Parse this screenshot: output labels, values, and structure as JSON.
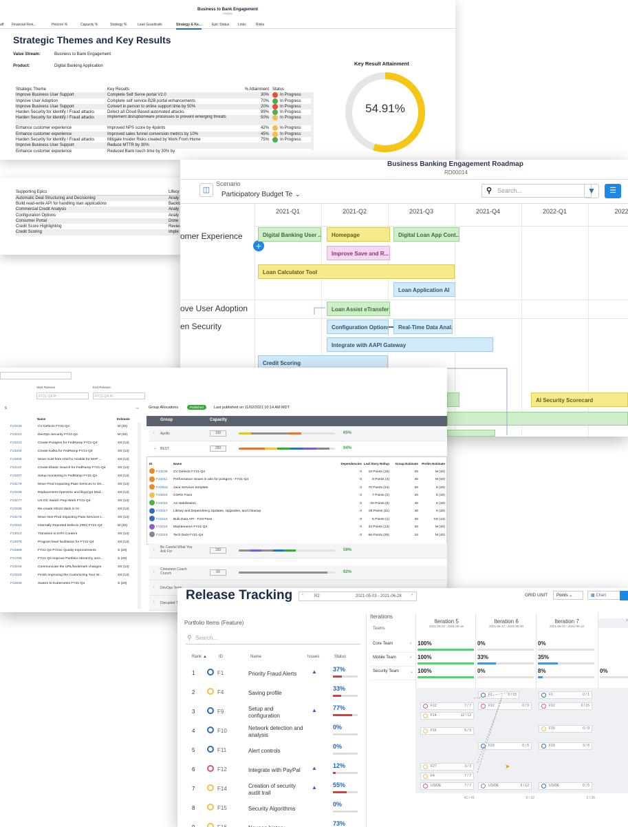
{
  "panel1": {
    "app_title": "Business to Bank Engagement",
    "app_code": "VS0002",
    "tabs": [
      "aff",
      "Financial Revi...",
      "Horizon %",
      "Capacity %",
      "Strategy %",
      "Lean Guardrails",
      "Strategy & Ke...",
      "Epic Status",
      "Links",
      "Risks"
    ],
    "heading": "Strategic Themes and Key Results",
    "value_stream_label": "Value Stream:",
    "value_stream": "Business to Bank Engagement",
    "product_label": "Product:",
    "product": "Digital Banking Application",
    "cols": [
      "Strategic Theme",
      "Key Results",
      "% Attainment",
      "Status"
    ],
    "rows": [
      {
        "theme": "Improve Business User Support",
        "kr": "Complete Self Serve portal V2.0",
        "pct": "30%",
        "status": "In Progress",
        "color": "#e8503a"
      },
      {
        "theme": "Improve User Adoption",
        "kr": "Complete self service B2B portal enhancements",
        "pct": "70%",
        "status": "In Progress",
        "color": "#4caf50"
      },
      {
        "theme": "Improve Business User Support",
        "kr": "Convert in person to online support time by 50%",
        "pct": "20%",
        "status": "In Progress",
        "color": "#e8503a"
      },
      {
        "theme": "Harden Security for Identify / Fraud attacks",
        "kr": "Detect all Cloud Based automated attacks",
        "pct": "99%",
        "status": "In Progress",
        "color": "#4caf50"
      },
      {
        "theme": "Harden Security for Identify / Fraud attacks",
        "kr": "Implement disruptionware processes to prevent emerging threats",
        "pct": "50%",
        "status": "In Progress",
        "color": "#f5c04a"
      },
      {
        "theme": "Enhance customer experience",
        "kr": "Improved NPS score by 4points",
        "pct": "42%",
        "status": "In Progress",
        "color": "#f5c04a"
      },
      {
        "theme": "Enhance customer experience",
        "kr": "Improved sales funnel conversion metrics by 10%",
        "pct": "45%",
        "status": "In Progress",
        "color": "#f5c04a"
      },
      {
        "theme": "Harden Security for Identify / Fraud attacks",
        "kr": "Mitigate Insider Risks created by Work From Home",
        "pct": "75%",
        "status": "In Progress",
        "color": "#4caf50"
      },
      {
        "theme": "Improve Business User Support",
        "kr": "Reduce MTTR by 30%",
        "pct": "",
        "status": "",
        "color": ""
      },
      {
        "theme": "Enhance customer experience",
        "kr": "Reduced Bank touch time by 30% by",
        "pct": "",
        "status": "",
        "color": ""
      }
    ],
    "gauge_title": "Key Result Attainment",
    "gauge_value": "54.91%",
    "gauge_fraction": 0.5491,
    "epics_col": "Supporting Epics",
    "lifecycle_col": "Lifecy",
    "epics": [
      {
        "name": "Automatic Deal Structuring and Decisioning",
        "lc": "Analy"
      },
      {
        "name": "Build read-write API for handling loan applications",
        "lc": "Backlo"
      },
      {
        "name": "Commercial Credit Analysis",
        "lc": "Analy"
      },
      {
        "name": "Configuration Options",
        "lc": "Analy"
      },
      {
        "name": "Consumer Portal",
        "lc": "Done"
      },
      {
        "name": "Credit Score Highlighting",
        "lc": "Reviev"
      },
      {
        "name": "Credit Scoring",
        "lc": "Imple"
      }
    ]
  },
  "panel2": {
    "title": "Business Banking Engagement Roadmap",
    "code": "RD00014",
    "scenario_label": "Scenario",
    "scenario_value": "Participatory Budget Te",
    "search_placeholder": "Search...",
    "quarters": [
      "2021-Q1",
      "2021-Q2",
      "2021-Q3",
      "2021-Q4",
      "2022-Q1",
      "2022"
    ],
    "themes": [
      "omer Experience",
      "ove User Adoption",
      "en Security"
    ],
    "items": [
      "Digital Banking User ...",
      "Homepage",
      "Digital Loan App Cont...",
      "Improve Save and R...",
      "Loan Calculator Tool",
      "Loan Application AI",
      "Loan Assist eTransfer",
      "Configuration Options",
      "Real-Time Data Anal...",
      "Integrate with AAPI Gateway",
      "Credit Scoring",
      "AI Security Scorecard"
    ]
  },
  "panel3": {
    "start_release_label": "Start Release",
    "start_release": "FY21-Q4 PI",
    "end_release_label": "End Release",
    "end_release": "FY21-Q4 PI",
    "list_title": "s",
    "list_cols": [
      "Name",
      "Estimate"
    ],
    "list": [
      [
        "F23108",
        "CV Defects FY21-Q4",
        "M (40)"
      ],
      [
        "F23161",
        "DevOps Security FY21-Q4",
        "M (40)"
      ],
      [
        "F23231",
        "Create Postgres for FedRamp FY21-Q4",
        "XS (13)"
      ],
      [
        "F23204",
        "Create Kafka for FedRamp FY21-Q4",
        "XS (13)"
      ],
      [
        "F23205",
        "Move ALM from Chef to Ansible for MVP ...",
        "XS (13)"
      ],
      [
        "F22110",
        "Create Elastic Search for FedRamp FY21-Q4",
        "XS (13)"
      ],
      [
        "F23207",
        "Setup monitoring in FedRamp FY21-Q4",
        "XS (13)"
      ],
      [
        "F23179",
        "Move Prod Impacting Paas Services to GK...",
        "XS (13)"
      ],
      [
        "F23198",
        "Replacement OpenSSL and libgcrypt Mod...",
        "XS (13)"
      ],
      [
        "F23177",
        "US DC Switch Prep Work FY21-Q4",
        "XS (13)"
      ],
      [
        "F23195",
        "Re-create Ghost slack in GI",
        "XS (13)"
      ],
      [
        "F23178",
        "Move Non-Prod Impacting Paas Services t...",
        "XS (13)"
      ],
      [
        "F23181",
        "Internally Reported Defects (IRD) FY21-Q4",
        "M (40)"
      ],
      [
        "F23014",
        "Transition to DITA Content",
        "XS (13)"
      ],
      [
        "F23078",
        "Program level facilitation for FY21-Q4",
        "XS (13)"
      ],
      [
        "F22869",
        "FY21-Q4 PI Doc Quality Improvements",
        "S (20)"
      ],
      [
        "F21765",
        "FY21-Q4 Improve Portfolio Hierarchy sect...",
        "S (20)"
      ],
      [
        "F23194",
        "Communicate the URL/bookmark changes",
        "XS (13)"
      ],
      [
        "F23160",
        "Finish Improving the Customizing Your W...",
        "XS (13)"
      ],
      [
        "F22636",
        "Swarm to Kubernetes FY21-Q4",
        "S (20)"
      ]
    ],
    "alloc_title": "Group Allocations",
    "published_badge": "Published",
    "published_text": "Last published on 11/02/2021 10:14 AM MDT",
    "group_col": "Group",
    "capacity_col": "Capacity",
    "groups": [
      {
        "name": "Apollo",
        "cap": "100",
        "pct": "65%"
      },
      {
        "name": "BEST",
        "cap": "250",
        "pct": "94%"
      }
    ],
    "sub_cols": [
      "ID",
      "Name",
      "Dependencies",
      "Leaf Story Rollup",
      "Group Estimate",
      "Prelim Estimate"
    ],
    "sub_rows": [
      [
        "F23108",
        "CV Defects FY21-Q4",
        "0",
        "19 Points (16)",
        "25",
        "M (40)",
        "#f08a24"
      ],
      [
        "F23211",
        "Performance Issues in alm for postgres - FY21-Q4",
        "0",
        "9 Points (4)",
        "40",
        "M (40)",
        "#f08a24"
      ],
      [
        "F22933",
        "Java Services template",
        "0",
        "70 Points (24)",
        "20",
        "S (20)",
        "#f08a24"
      ],
      [
        "F23024",
        "CORS Fixes",
        "0",
        "7 Points (2)",
        "20",
        "S (20)",
        "#f5c04a"
      ],
      [
        "F23216",
        "A2 stabilization",
        "0",
        "20 Points (5)",
        "40",
        "S (20)",
        "#4caf50"
      ],
      [
        "F23217",
        "Library and Dependency Updates, Upgrades, and Cleanup",
        "0",
        "29 Points (11)",
        "40",
        "S (20)",
        "#2f6fb7"
      ],
      [
        "F23215",
        "Bulk Data API - First Pass",
        "0",
        "5 Points (1)",
        "20",
        "XS (13)",
        "#2f6fb7"
      ],
      [
        "F23218",
        "Maintenance FY21-Q4",
        "0",
        "23 Points (13)",
        "20",
        "M (40)",
        "#8e5bd0"
      ],
      [
        "F23219",
        "Tech Debt FY21-Q4",
        "0",
        "66 Points (25)",
        "10",
        "M (40)",
        "#888888"
      ]
    ],
    "groups2": [
      {
        "name": "Be Careful What You Ask For",
        "cap": "150",
        "pct": "59%"
      },
      {
        "name": "Cinnamon Coach Crunch",
        "cap": "50",
        "pct": "92%"
      },
      {
        "name": "DevOps Team"
      },
      {
        "name": "Disrupted Ti"
      }
    ]
  },
  "panel4": {
    "title": "Release Tracking",
    "release": "R2",
    "dates": "2021-05-03 - 2021-06-28",
    "grid_unit_label": "GRID UNIT",
    "grid_unit": "Points",
    "chart_btn": "Chart",
    "portfolio_title": "Portfolio Items (Feature)",
    "search_placeholder": "Search...",
    "cols": [
      "Rank",
      "ID",
      "Name",
      "Issues",
      "Status"
    ],
    "rows": [
      {
        "rank": "1",
        "id": "F1",
        "name": "Priority Fraud Alerts",
        "warn": true,
        "pct": "37%",
        "fill": 0.37,
        "color": "#2f6fb7"
      },
      {
        "rank": "2",
        "id": "F4",
        "name": "Saving profile",
        "warn": false,
        "pct": "33%",
        "fill": 0.33,
        "color": "#f5c04a"
      },
      {
        "rank": "3",
        "id": "F9",
        "name": "Setup and configuration",
        "warn": true,
        "pct": "77%",
        "fill": 0.77,
        "color": "#2f6fb7"
      },
      {
        "rank": "4",
        "id": "F10",
        "name": "Network detection and analysis",
        "warn": false,
        "pct": "0%",
        "fill": 0,
        "color": "#2f6fb7"
      },
      {
        "rank": "5",
        "id": "F11",
        "name": "Alert controls",
        "warn": false,
        "pct": "0%",
        "fill": 0,
        "color": "#2f6fb7"
      },
      {
        "rank": "6",
        "id": "F12",
        "name": "Integrate with PayPal",
        "warn": true,
        "pct": "12%",
        "fill": 0.12,
        "color": "#e05468"
      },
      {
        "rank": "7",
        "id": "F14",
        "name": "Creation of security audit trail",
        "warn": true,
        "pct": "55%",
        "fill": 0.55,
        "color": "#f5c04a"
      },
      {
        "rank": "8",
        "id": "F15",
        "name": "Security Algorithms",
        "warn": false,
        "pct": "0%",
        "fill": 0,
        "color": "#f5c04a"
      },
      {
        "rank": "9",
        "id": "F16",
        "name": "Nexgen history",
        "warn": false,
        "pct": "73%",
        "fill": 0.73,
        "color": "#f5c04a"
      }
    ],
    "iterations_title": "Iterations",
    "teams_col": "Teams",
    "iterations": [
      {
        "name": "Iteration 5",
        "dates": "2021-05-03 - 2021-05-16",
        "total": "41 / 41"
      },
      {
        "name": "Iteration 6",
        "dates": "2021-05-17 - 2021-05-30",
        "total": "0 / 32"
      },
      {
        "name": "Iteration 7",
        "dates": "2021-05-31 - 2021-06-13",
        "total": "3 / 36"
      },
      {
        "name": "",
        "dates": "202",
        "total": ""
      }
    ],
    "teams": [
      {
        "name": "Core Team",
        "vals": [
          "100%",
          "0%",
          "0%"
        ],
        "fills": [
          1,
          0,
          0
        ]
      },
      {
        "name": "Mobile Team",
        "vals": [
          "100%",
          "33%",
          "35%"
        ],
        "fills": [
          1,
          0.33,
          0.35
        ]
      },
      {
        "name": "Security Team",
        "vals": [
          "100%",
          "0%",
          "8%",
          "0%"
        ],
        "fills": [
          1,
          0,
          0.08,
          0
        ]
      }
    ],
    "cards": [
      {
        "n": "F1",
        "v": "0 / 15",
        "c": "#2f6fb7"
      },
      {
        "n": "F12",
        "v": "7 / 7",
        "c": "#e05468"
      },
      {
        "n": "F12",
        "v": "0 / 0",
        "c": "#e05468"
      },
      {
        "n": "F14",
        "v": "12 / 12",
        "c": "#f5c04a"
      },
      {
        "n": "F1",
        "v": "0 / 1",
        "c": "#2f6fb7"
      },
      {
        "n": "F12",
        "v": "0 / 15",
        "c": "#e05468"
      },
      {
        "n": "F15",
        "v": "0 / 9",
        "c": "#f5c04a"
      },
      {
        "n": "F16",
        "v": "5 / 5",
        "c": "#f5c04a"
      },
      {
        "n": "F23",
        "v": "0 / 5",
        "c": "#2f6fb7"
      },
      {
        "n": "F23",
        "v": "3 / 6",
        "c": "#2f6fb7"
      },
      {
        "n": "F27",
        "v": "3 / 3",
        "c": "#f5c04a"
      },
      {
        "n": "F4",
        "v": "7 / 7",
        "c": "#f5c04a"
      },
      {
        "n": "US/DE",
        "v": "7 / 7",
        "c": "#e05468"
      },
      {
        "n": "US/DE",
        "v": "0 / 12",
        "c": "#888"
      },
      {
        "n": "US/DE",
        "v": "0 / 5",
        "c": "#2f6fb7"
      }
    ]
  }
}
